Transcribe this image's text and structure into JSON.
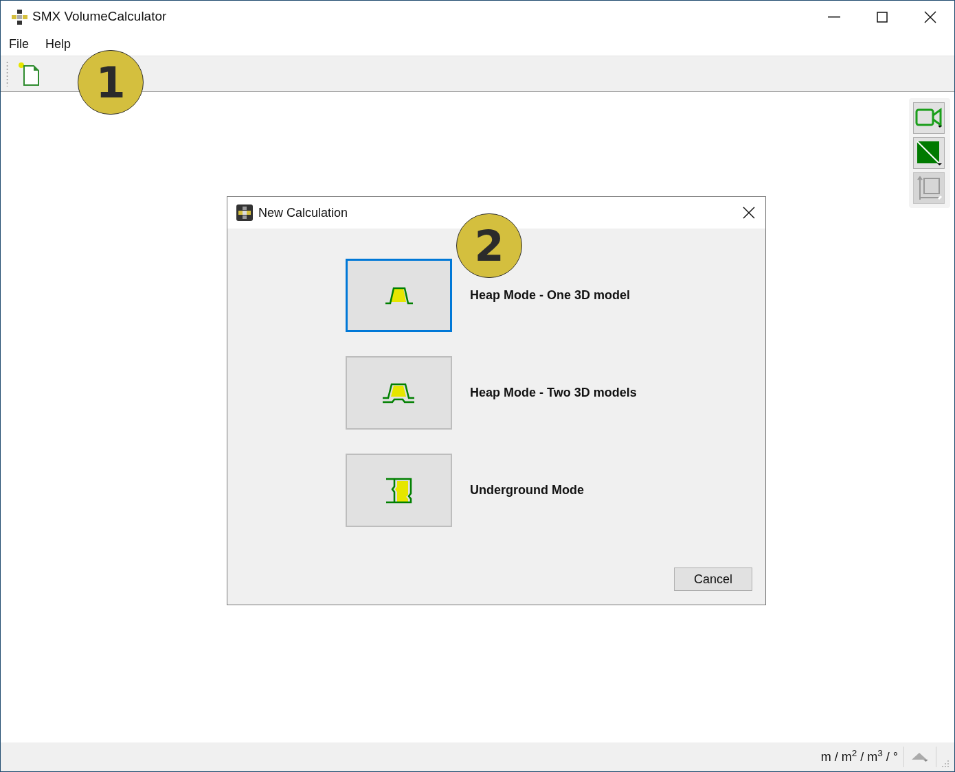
{
  "window": {
    "title": "SMX VolumeCalculator"
  },
  "menu": [
    "File",
    "Help"
  ],
  "dialog": {
    "title": "New Calculation",
    "options": [
      {
        "kind": "heap-one",
        "label": "Heap Mode - One 3D model",
        "selected": true
      },
      {
        "kind": "heap-two",
        "label": "Heap Mode - Two 3D models",
        "selected": false
      },
      {
        "kind": "underground",
        "label": "Underground Mode",
        "selected": false
      }
    ],
    "cancel": "Cancel"
  },
  "status_bar": {
    "units": "m / m$^{2}$ / m$^{3}$ / °"
  },
  "callouts": [
    "1",
    "2"
  ]
}
